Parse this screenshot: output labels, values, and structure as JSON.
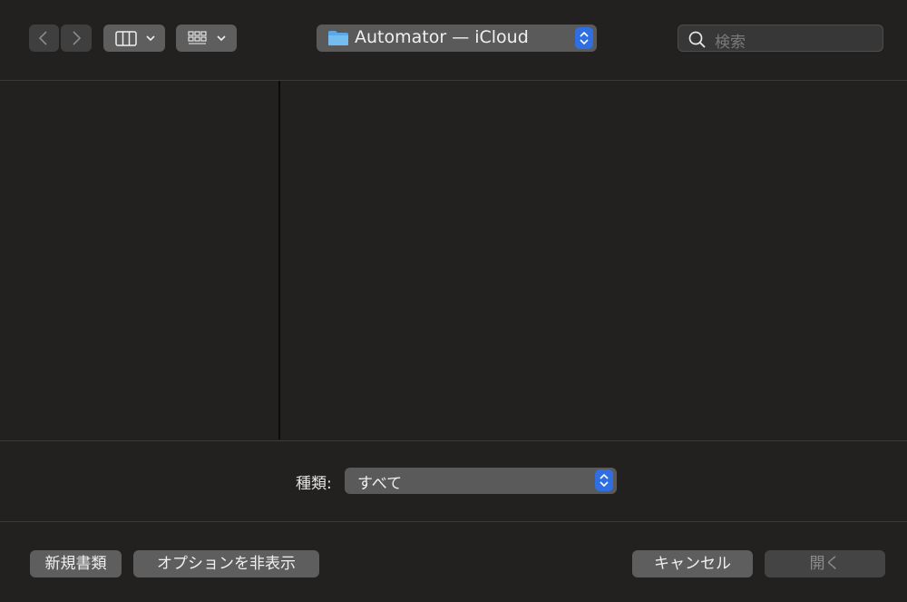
{
  "toolbar": {
    "back_icon": "chevron-left-icon",
    "forward_icon": "chevron-right-icon",
    "view_column_icon": "column-view-icon",
    "view_grid_icon": "icon-grid-view-icon",
    "location": {
      "label": "Automator — iCloud",
      "icon": "folder-icon"
    },
    "search": {
      "placeholder": "検索"
    }
  },
  "filter": {
    "label": "種類:",
    "selected": "すべて"
  },
  "buttons": {
    "new_document": "新規書類",
    "hide_options": "オプションを非表示",
    "cancel": "キャンセル",
    "open": "開く"
  },
  "colors": {
    "accent": "#2f6fe1",
    "background": "#222120",
    "button": "#5e5e5e"
  }
}
